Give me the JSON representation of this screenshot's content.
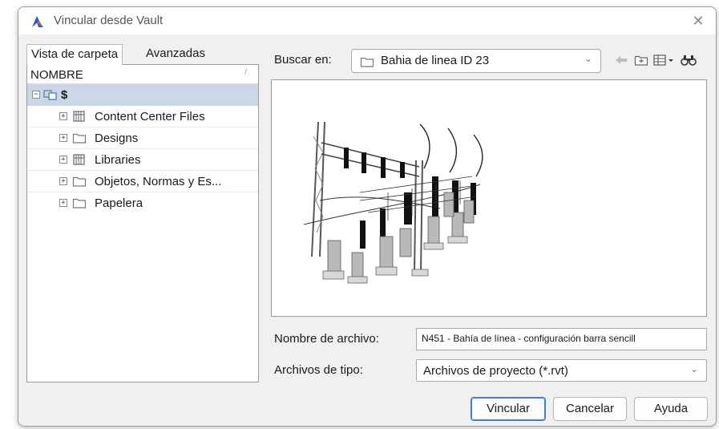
{
  "window": {
    "title": "Vincular desde Vault",
    "close_icon": "close-icon"
  },
  "tabs": [
    {
      "label": "Vista de carpeta",
      "active": true
    },
    {
      "label": "Avanzadas",
      "active": false
    }
  ],
  "tree": {
    "header": "NOMBRE",
    "root": {
      "label": "$",
      "expander": "−"
    },
    "items": [
      {
        "label": "Content Center Files",
        "icon": "library-icon",
        "expander": "+"
      },
      {
        "label": "Designs",
        "icon": "folder-icon",
        "expander": "+"
      },
      {
        "label": "Libraries",
        "icon": "library-icon",
        "expander": "+"
      },
      {
        "label": "Objetos, Normas y Es...",
        "icon": "folder-icon",
        "expander": "+"
      },
      {
        "label": "Papelera",
        "icon": "folder-icon",
        "expander": "+"
      }
    ]
  },
  "lookin": {
    "label": "Buscar en:",
    "value": "Bahia de linea ID 23"
  },
  "toolbar": {
    "back_icon": "back-arrow-icon",
    "new_folder_icon": "new-folder-icon",
    "view_icon": "view-menu-icon",
    "find_icon": "binoculars-icon"
  },
  "filename": {
    "label": "Nombre de archivo:",
    "value": "N451 - Bahía de línea - configuración barra sencill"
  },
  "filetype": {
    "label": "Archivos de tipo:",
    "value": "Archivos de proyecto (*.rvt)"
  },
  "buttons": {
    "link": "Vincular",
    "cancel": "Cancelar",
    "help": "Ayuda"
  },
  "colors": {
    "selection": "#c9d7e6",
    "accent": "#3b7fd1",
    "folder": "#7a7a7a"
  }
}
